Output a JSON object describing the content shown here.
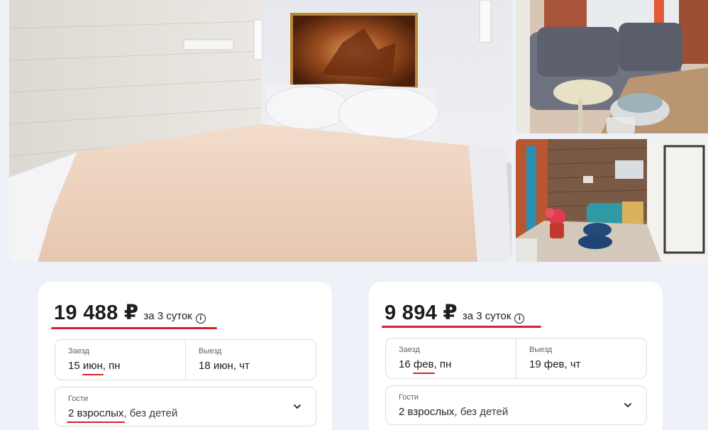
{
  "gallery": {
    "main_photo": "bedroom-with-ship-painting",
    "side_top_photo": "gray-sofa-with-dishes",
    "side_bottom_photo": "kitchen-with-flowers"
  },
  "cards": [
    {
      "price": "19 488 ₽",
      "per_nights": "за 3 суток",
      "info_icon": "i",
      "checkin_label": "Заезд",
      "checkin_day": "15",
      "checkin_month": "июн",
      "checkin_weekday": ", пн",
      "checkout_label": "Выезд",
      "checkout_value": "18 июн, чт",
      "guests_label": "Гости",
      "guests_adults": "2 взрослых",
      "guests_rest": ", без детей"
    },
    {
      "price": "9 894 ₽",
      "per_nights": "за 3 суток",
      "info_icon": "i",
      "checkin_label": "Заезд",
      "checkin_day": "16",
      "checkin_month": "фев",
      "checkin_weekday": ", пн",
      "checkout_label": "Выезд",
      "checkout_value": "19 фев, чт",
      "guests_label": "Гости",
      "guests_adults": "2 взрослых",
      "guests_rest": ", без детей"
    }
  ],
  "colors": {
    "accent_underline": "#d8202a",
    "page_background": "#eef1f8",
    "card_background": "#ffffff"
  }
}
